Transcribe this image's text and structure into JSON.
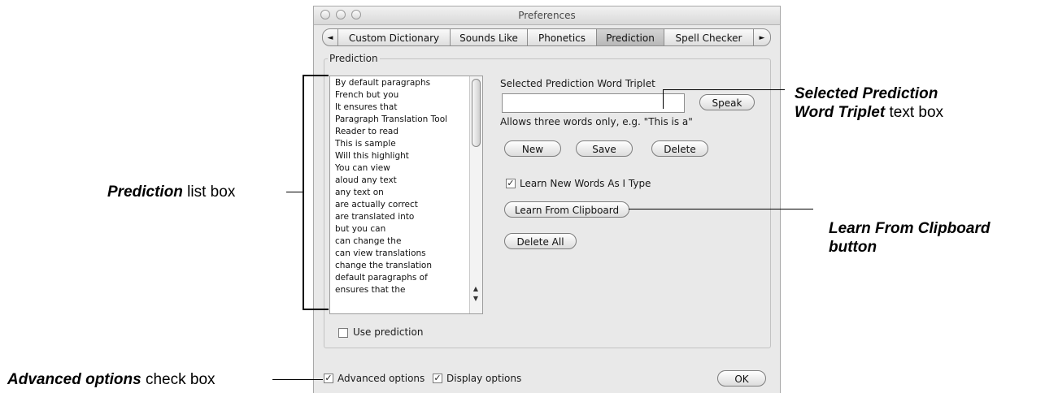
{
  "window": {
    "title": "Preferences"
  },
  "tabs": [
    {
      "label": "◄"
    },
    {
      "label": "Custom Dictionary"
    },
    {
      "label": "Sounds Like"
    },
    {
      "label": "Phonetics"
    },
    {
      "label": "Prediction",
      "selected": true
    },
    {
      "label": "Spell Checker"
    },
    {
      "label": "►"
    }
  ],
  "prediction_group": {
    "label": "Prediction",
    "list_items": [
      "By default paragraphs",
      "French but you",
      "It ensures that",
      "Paragraph Translation Tool",
      "Reader to read",
      "This is sample",
      "Will this highlight",
      "You can view",
      "aloud any text",
      "any text on",
      "are actually correct",
      "are translated into",
      "but you can",
      "can change the",
      "can view translations",
      "change the translation",
      "default paragraphs of",
      "ensures that the"
    ],
    "triplet_label": "Selected Prediction Word Triplet",
    "triplet_value": "",
    "speak_button": "Speak",
    "hint": "Allows three words only, e.g. \"This is a\"",
    "new_button": "New",
    "save_button": "Save",
    "delete_button": "Delete",
    "learn_new_words": {
      "label": "Learn New Words As I Type",
      "checked": true
    },
    "learn_clipboard_button": "Learn From Clipboard",
    "delete_all_button": "Delete All",
    "use_prediction": {
      "label": "Use prediction",
      "checked": false
    }
  },
  "footer": {
    "advanced_options": {
      "label": "Advanced options",
      "checked": true
    },
    "display_options": {
      "label": "Display options",
      "checked": true
    },
    "ok_button": "OK"
  },
  "callouts": {
    "prediction_list": {
      "bold": "Prediction",
      "rest": " list box"
    },
    "triplet": {
      "bold1": "Selected Prediction",
      "bold2": "Word Triplet",
      "rest": " text box"
    },
    "clipboard": {
      "line1": "Learn From Clipboard",
      "line2": "button"
    },
    "advanced": {
      "bold": "Advanced options",
      "rest": " check box"
    }
  },
  "check_mark": "✓"
}
